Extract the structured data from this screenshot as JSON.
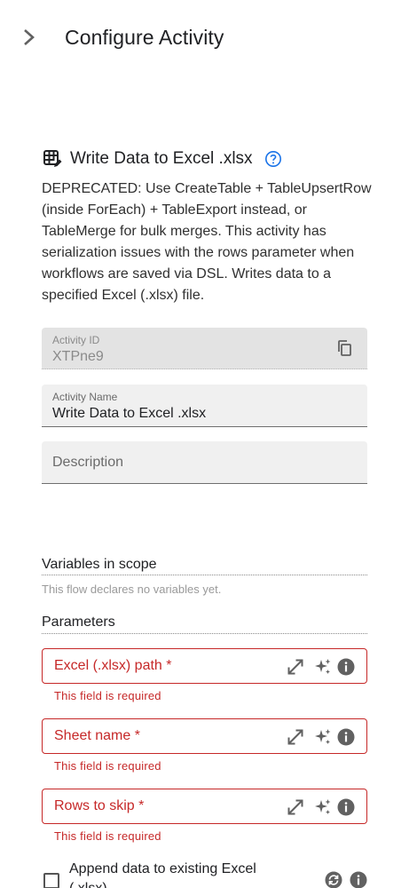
{
  "header": {
    "title": "Configure Activity",
    "collapse_icon": "chevron-right-icon"
  },
  "activity": {
    "icon": "table-edit-icon",
    "title": "Write Data to Excel .xlsx",
    "help_icon": "help-circle-icon",
    "description": "DEPRECATED: Use CreateTable + TableUpsertRow (inside ForEach) + TableExport instead, or TableMerge for bulk merges. This activity has serialization issues with the rows parameter when workflows are saved via DSL. Writes data to a specified Excel (.xlsx) file."
  },
  "fields": {
    "activity_id": {
      "label": "Activity ID",
      "value": "XTPne9",
      "icon": "copy-icon"
    },
    "activity_name": {
      "label": "Activity Name",
      "value": "Write Data to Excel .xlsx"
    },
    "description": {
      "placeholder": "Description",
      "value": ""
    }
  },
  "variables": {
    "title": "Variables in scope",
    "empty_text": "This flow declares no variables yet."
  },
  "parameters": {
    "title": "Parameters",
    "items": [
      {
        "label": "Excel (.xlsx) path *",
        "error": "This field is required"
      },
      {
        "label": "Sheet name *",
        "error": "This field is required"
      },
      {
        "label": "Rows to skip *",
        "error": "This field is required"
      }
    ],
    "checkbox": {
      "label": "Append data to existing Excel (.xlsx)",
      "checked": false
    }
  },
  "colors": {
    "error": "#c62828",
    "icon": "#616161",
    "accent": "#1a73e8"
  }
}
